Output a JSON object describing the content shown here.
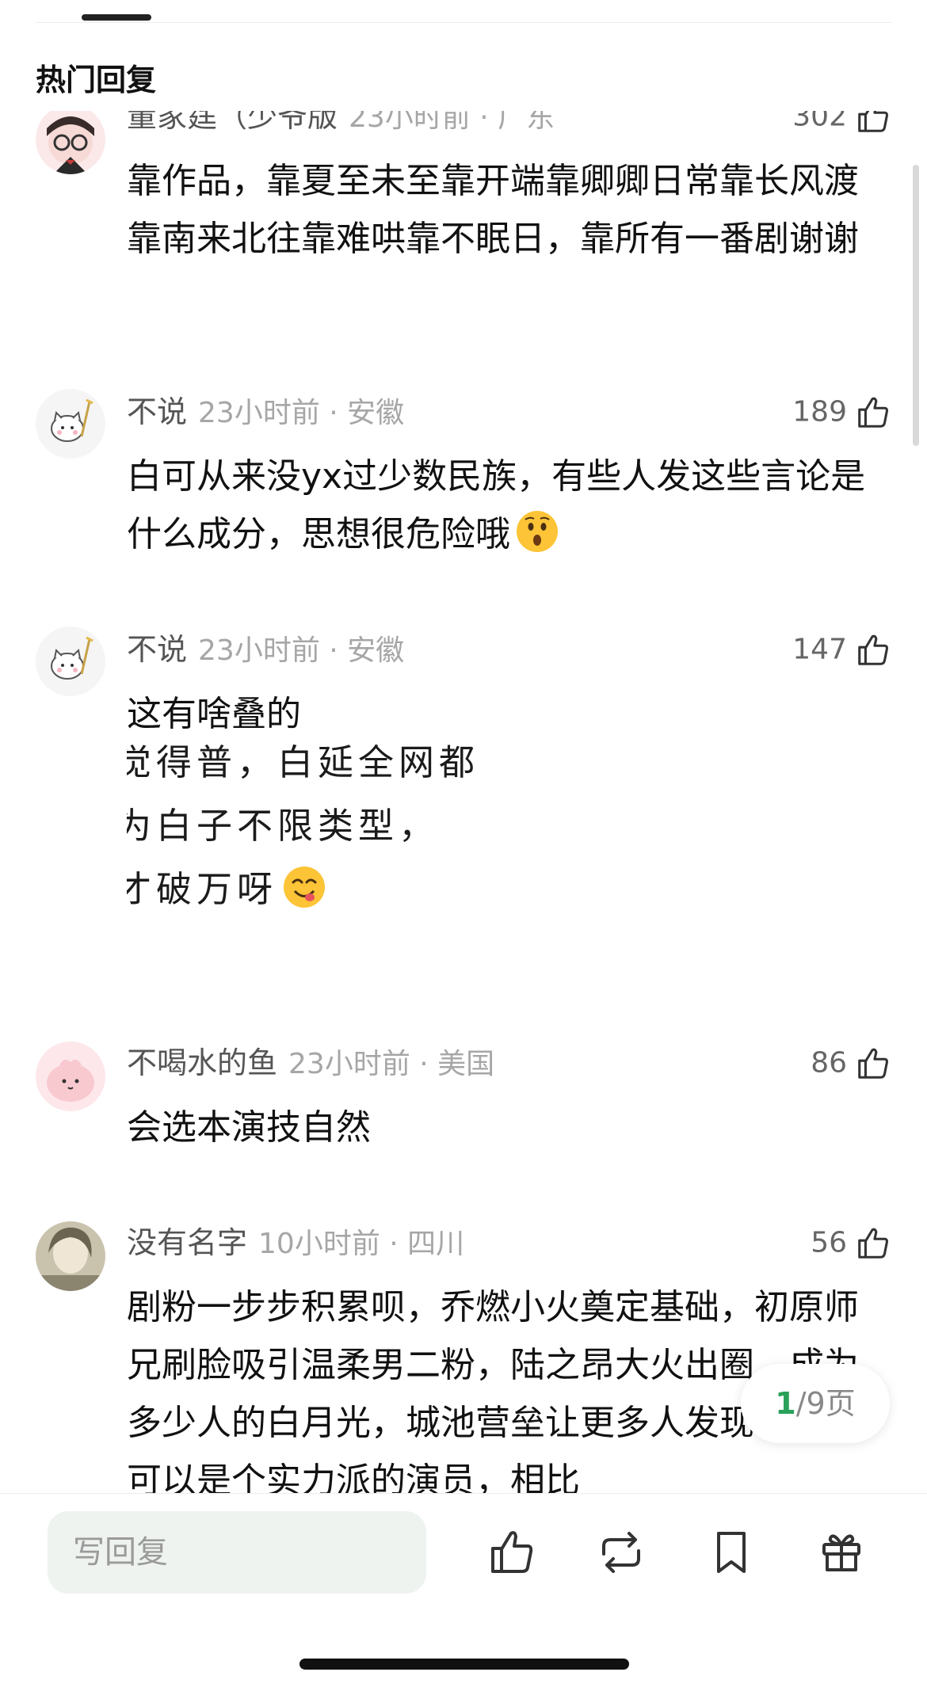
{
  "header": {
    "section_title": "热门回复"
  },
  "comments": [
    {
      "username": "董家莛（少爷版",
      "info": "23小时前 · 广东",
      "likes": "302",
      "text": "靠作品，靠夏至未至靠开端靠卿卿日常靠长风渡靠南来北往靠难哄靠不眠日，靠所有一番剧谢谢"
    },
    {
      "username": "不说",
      "info": "23小时前 · 安徽",
      "likes": "189",
      "text": "白可从来没yx过少数民族，有些人发这些言论是什么成分，思想很危险哦",
      "emoji": "hushed-face-emoji"
    },
    {
      "username": "不说",
      "info": "23小时前 · 安徽",
      "likes": "147",
      "text": "这有啥叠的",
      "quote_lines": [
        "觉得普，白延全网都",
        "为白子不限类型，",
        "才破万呀"
      ],
      "quote_emoji": "yum-face-emoji"
    },
    {
      "username": "不喝水的鱼",
      "info": "23小时前 · 美国",
      "likes": "86",
      "text": "会选本演技自然"
    },
    {
      "username": "没有名字",
      "info": "10小时前 · 四川",
      "likes": "56",
      "text": "剧粉一步步积累呗，乔燃小火奠定基础，初原师兄刷脸吸引温柔男二粉，陆之昂大火出圈，成为多少人的白月光，城池营垒让更多人发现他真的可以是个实力派的演员，相比"
    }
  ],
  "pager": {
    "current": "1",
    "total_label": "/9页"
  },
  "bottom_bar": {
    "reply_placeholder": "写回复",
    "icons": [
      "like-icon",
      "repost-icon",
      "bookmark-icon",
      "gift-icon"
    ]
  },
  "colors": {
    "accent": "#2aa15a",
    "reply_bg": "#eef3ef",
    "meta_gray": "#a6a6a6"
  }
}
